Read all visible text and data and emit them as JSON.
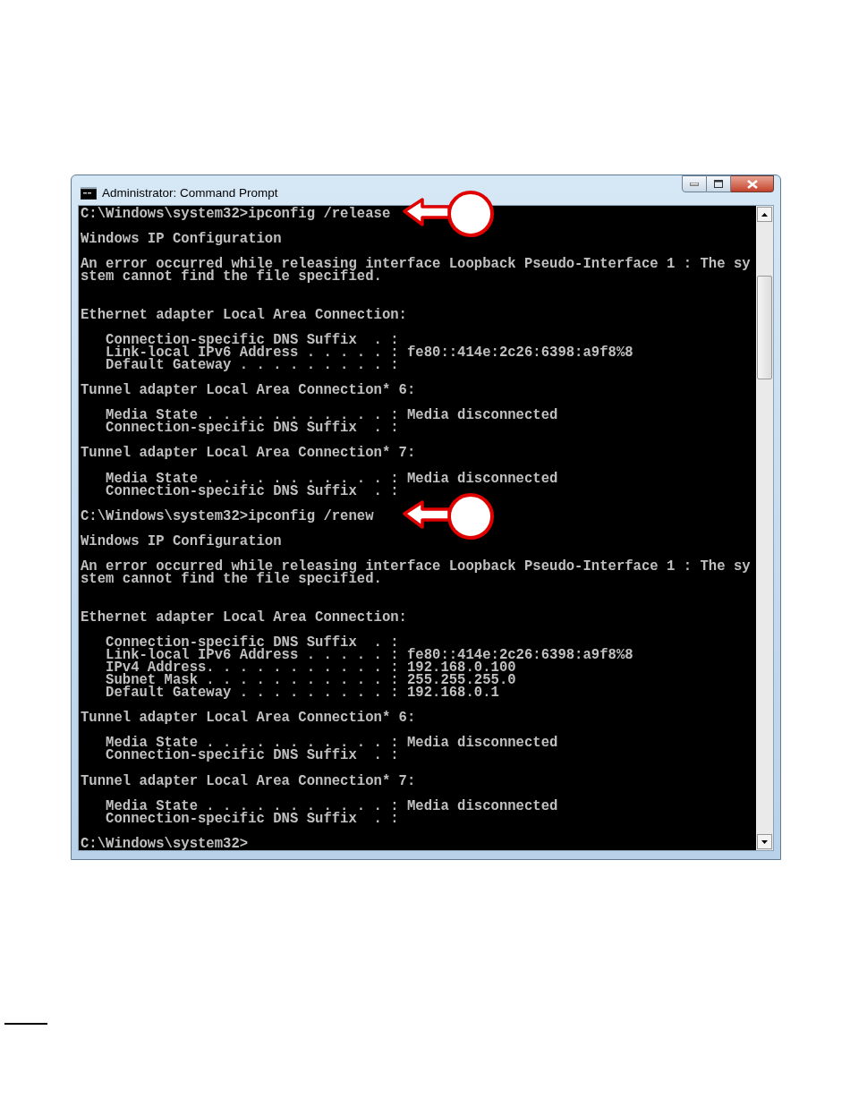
{
  "window": {
    "title": "Administrator: Command Prompt"
  },
  "console": {
    "lines": [
      {
        "kind": "text",
        "text": "C:\\Windows\\system32>ipconfig /release",
        "callout": true
      },
      {
        "kind": "blank"
      },
      {
        "kind": "text",
        "text": "Windows IP Configuration"
      },
      {
        "kind": "blank"
      },
      {
        "kind": "text",
        "text": "An error occurred while releasing interface Loopback Pseudo-Interface 1 : The sy"
      },
      {
        "kind": "text",
        "text": "stem cannot find the file specified."
      },
      {
        "kind": "blank"
      },
      {
        "kind": "blank"
      },
      {
        "kind": "text",
        "text": "Ethernet adapter Local Area Connection:"
      },
      {
        "kind": "blank"
      },
      {
        "kind": "text",
        "text": "   Connection-specific DNS Suffix  . :"
      },
      {
        "kind": "text",
        "text": "   Link-local IPv6 Address . . . . . : fe80::414e:2c26:6398:a9f8%8"
      },
      {
        "kind": "text",
        "text": "   Default Gateway . . . . . . . . . :"
      },
      {
        "kind": "blank"
      },
      {
        "kind": "text",
        "text": "Tunnel adapter Local Area Connection* 6:"
      },
      {
        "kind": "blank"
      },
      {
        "kind": "text",
        "text": "   Media State . . . . . . . . . . . : Media disconnected"
      },
      {
        "kind": "text",
        "text": "   Connection-specific DNS Suffix  . :"
      },
      {
        "kind": "blank"
      },
      {
        "kind": "text",
        "text": "Tunnel adapter Local Area Connection* 7:"
      },
      {
        "kind": "blank"
      },
      {
        "kind": "text",
        "text": "   Media State . . . . . . . . . . . : Media disconnected"
      },
      {
        "kind": "text",
        "text": "   Connection-specific DNS Suffix  . :"
      },
      {
        "kind": "blank"
      },
      {
        "kind": "text",
        "text": "C:\\Windows\\system32>ipconfig /renew",
        "callout": true
      },
      {
        "kind": "blank"
      },
      {
        "kind": "text",
        "text": "Windows IP Configuration"
      },
      {
        "kind": "blank"
      },
      {
        "kind": "text",
        "text": "An error occurred while releasing interface Loopback Pseudo-Interface 1 : The sy"
      },
      {
        "kind": "text",
        "text": "stem cannot find the file specified."
      },
      {
        "kind": "blank"
      },
      {
        "kind": "blank"
      },
      {
        "kind": "text",
        "text": "Ethernet adapter Local Area Connection:"
      },
      {
        "kind": "blank"
      },
      {
        "kind": "text",
        "text": "   Connection-specific DNS Suffix  . :"
      },
      {
        "kind": "text",
        "text": "   Link-local IPv6 Address . . . . . : fe80::414e:2c26:6398:a9f8%8"
      },
      {
        "kind": "text",
        "text": "   IPv4 Address. . . . . . . . . . . : 192.168.0.100"
      },
      {
        "kind": "text",
        "text": "   Subnet Mask . . . . . . . . . . . : 255.255.255.0"
      },
      {
        "kind": "text",
        "text": "   Default Gateway . . . . . . . . . : 192.168.0.1"
      },
      {
        "kind": "blank"
      },
      {
        "kind": "text",
        "text": "Tunnel adapter Local Area Connection* 6:"
      },
      {
        "kind": "blank"
      },
      {
        "kind": "text",
        "text": "   Media State . . . . . . . . . . . : Media disconnected"
      },
      {
        "kind": "text",
        "text": "   Connection-specific DNS Suffix  . :"
      },
      {
        "kind": "blank"
      },
      {
        "kind": "text",
        "text": "Tunnel adapter Local Area Connection* 7:"
      },
      {
        "kind": "blank"
      },
      {
        "kind": "text",
        "text": "   Media State . . . . . . . . . . . : Media disconnected"
      },
      {
        "kind": "text",
        "text": "   Connection-specific DNS Suffix  . :"
      },
      {
        "kind": "blank"
      },
      {
        "kind": "text",
        "text": "C:\\Windows\\system32>"
      }
    ]
  }
}
